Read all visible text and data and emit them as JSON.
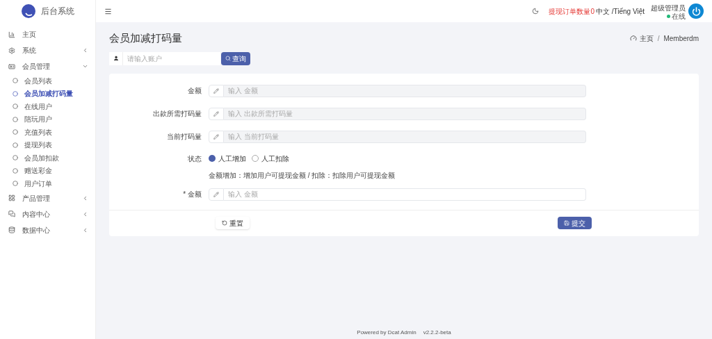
{
  "brand": "后台系统",
  "sidebar": {
    "items": [
      {
        "label": "主页",
        "selected": false
      },
      {
        "label": "系统",
        "expanded": false,
        "selected": false
      },
      {
        "label": "会员管理",
        "expanded": true,
        "selected": false,
        "children": [
          {
            "label": "会员列表",
            "selected": false
          },
          {
            "label": "会员加减打码量",
            "selected": true
          },
          {
            "label": "在线用户",
            "selected": false
          },
          {
            "label": "陪玩用户",
            "selected": false
          },
          {
            "label": "充值列表",
            "selected": false
          },
          {
            "label": "提现列表",
            "selected": false
          },
          {
            "label": "会员加扣款",
            "selected": false
          },
          {
            "label": "赠送彩金",
            "selected": false
          },
          {
            "label": "用户订单",
            "selected": false
          }
        ]
      },
      {
        "label": "产品管理",
        "expanded": false,
        "selected": false
      },
      {
        "label": "内容中心",
        "expanded": false,
        "selected": false
      },
      {
        "label": "数据中心",
        "expanded": false,
        "selected": false
      }
    ]
  },
  "topbar": {
    "withdraw_orders": "提现订单数量0",
    "language": "中文 /Tiếng Việt",
    "user": "超级管理员",
    "status": "在线"
  },
  "page": {
    "title": "会员加减打码量",
    "breadcrumb": [
      "主页",
      "/",
      "Memberdm"
    ]
  },
  "search": {
    "placeholder": "请输入账户",
    "button": "查询"
  },
  "form": {
    "fields": [
      {
        "label": "金额",
        "placeholder": "输入 金额",
        "disabled": true
      },
      {
        "label": "出款所需打码量",
        "placeholder": "输入 出款所需打码量",
        "disabled": true
      },
      {
        "label": "当前打码量",
        "placeholder": "输入 当前打码量",
        "disabled": true
      }
    ],
    "status": {
      "label": "状态",
      "options": [
        {
          "label": "人工增加",
          "selected": true
        },
        {
          "label": "人工扣除",
          "selected": false
        }
      ],
      "help": "金额增加：增加用户可提现金额 / 扣除：扣除用户可提现金额"
    },
    "amount": {
      "label": "* 金额",
      "placeholder": "输入 金额",
      "disabled": false
    },
    "reset": "重置",
    "submit": "提交"
  },
  "footer": {
    "powered": "Powered by Dcat Admin",
    "version": "v2.2.2-beta"
  }
}
